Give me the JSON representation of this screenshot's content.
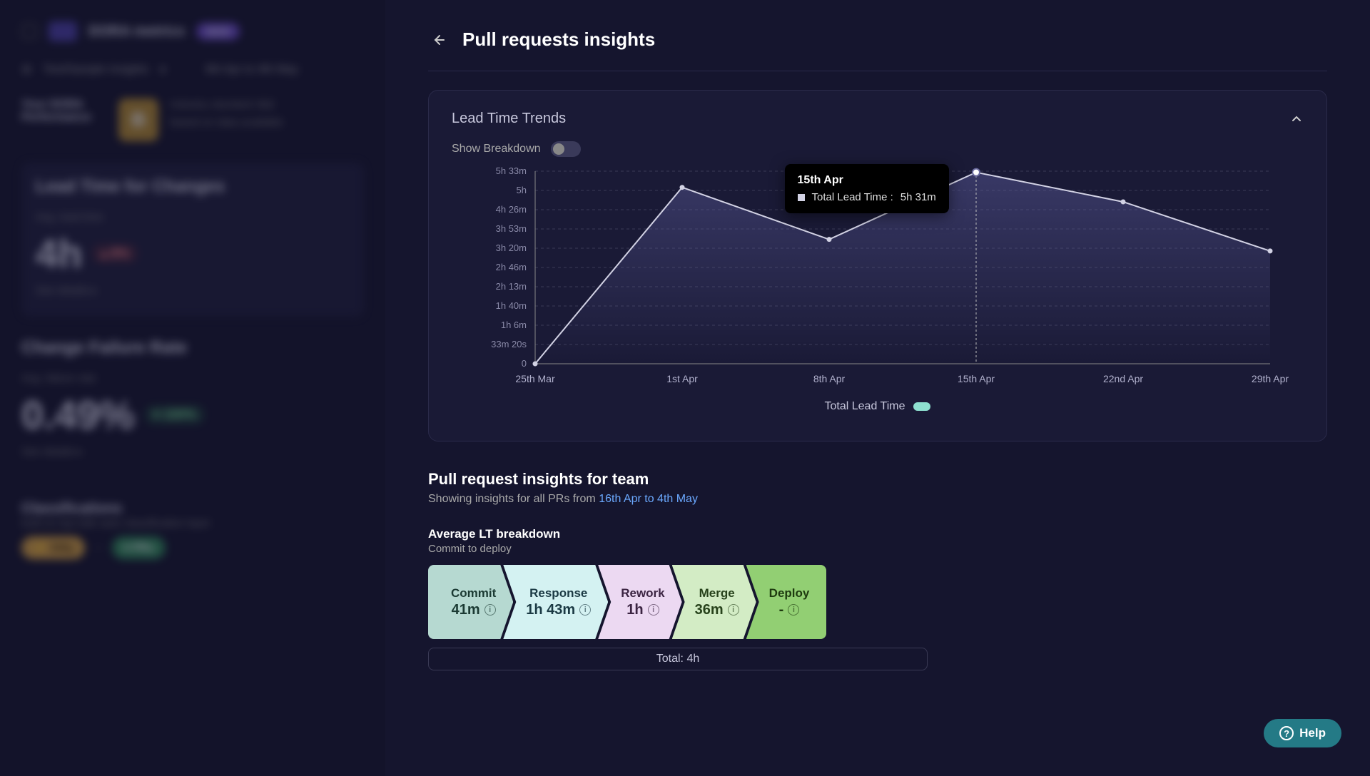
{
  "bg": {
    "nav_label": "DORA metrics",
    "nav_tag": "NEW",
    "team": "Test/Sample Insights",
    "dates": "6th Apr to 4th May",
    "perf_label": "Your DORA Performance",
    "perf_grade": "B",
    "ind_std_label": "Industry standard:",
    "ind_std_val": "8.2",
    "based_on": "based on data available",
    "ltc": {
      "title": "Lead Time for Changes",
      "avg_label": "Avg. lead time",
      "value": "4h",
      "delta": "8%",
      "details": "See details"
    },
    "cfr": {
      "title": "Change Failure Rate",
      "avg_label": "Avg. failure rate",
      "value": "0.49%",
      "delta": "100%",
      "details": "See details"
    },
    "class_title": "Classifications",
    "class_sub": "built on top-side auto classification layer",
    "silly": "Silly",
    "prs": "PRs"
  },
  "panel": {
    "title": "Pull requests insights"
  },
  "card": {
    "title": "Lead Time Trends",
    "toggle_label": "Show Breakdown",
    "legend": "Total Lead Time",
    "tooltip": {
      "date": "15th Apr",
      "label": "Total Lead Time :",
      "value": "5h 31m"
    }
  },
  "chart_data": {
    "type": "line",
    "title": "Lead Time Trends",
    "ylabel": "",
    "xlabel": "",
    "y_ticks": [
      "0",
      "33m 20s",
      "1h 6m",
      "1h 40m",
      "2h 13m",
      "2h 46m",
      "3h 20m",
      "3h 53m",
      "4h 26m",
      "5h",
      "5h 33m"
    ],
    "ylim_minutes": [
      0,
      333
    ],
    "categories": [
      "25th Mar",
      "1st Apr",
      "8th Apr",
      "15th Apr",
      "22nd Apr",
      "29th Apr"
    ],
    "series": [
      {
        "name": "Total Lead Time",
        "values_minutes": [
          0,
          305,
          215,
          331,
          280,
          195
        ],
        "color": "#d2d2e4"
      }
    ],
    "hover_index": 3
  },
  "section": {
    "title": "Pull request insights for team",
    "desc_prefix": "Showing insights for all PRs from ",
    "date_range": "16th Apr to 4th May"
  },
  "lt": {
    "title": "Average LT breakdown",
    "subtitle": "Commit to deploy",
    "segments": [
      {
        "name": "Commit",
        "value": "41m"
      },
      {
        "name": "Response",
        "value": "1h 43m"
      },
      {
        "name": "Rework",
        "value": "1h"
      },
      {
        "name": "Merge",
        "value": "36m"
      },
      {
        "name": "Deploy",
        "value": "-"
      }
    ],
    "total_label": "Total:",
    "total_value": "4h"
  },
  "help": "Help"
}
